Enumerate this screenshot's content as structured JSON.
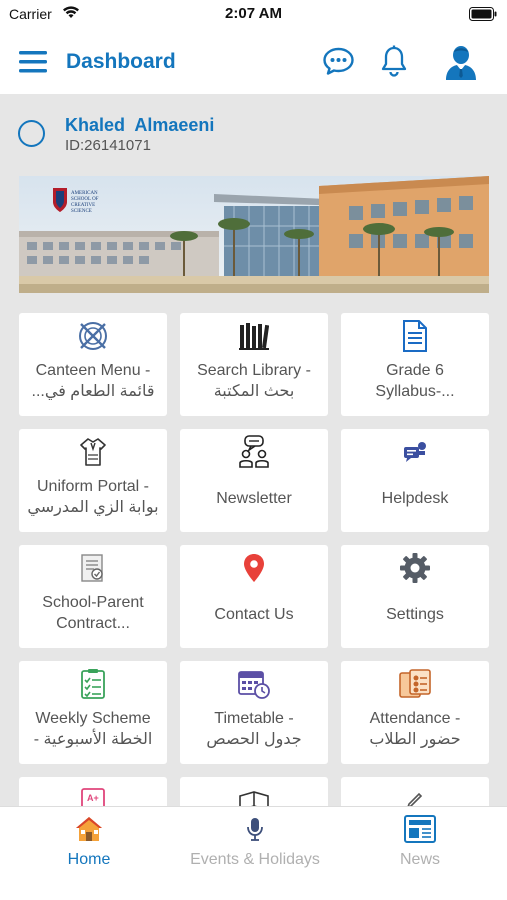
{
  "status_bar": {
    "carrier": "Carrier",
    "time": "2:07 AM"
  },
  "app_bar": {
    "title": "Dashboard"
  },
  "user": {
    "name": "Khaled  Almaeeni",
    "id": "ID:26141071"
  },
  "banner": {
    "school_name": "AMERICAN SCHOOL OF CREATIVE SCIENCE"
  },
  "tiles": [
    {
      "icon": "canteen-icon",
      "line1": "Canteen Menu -",
      "line2": "قائمة الطعام في..."
    },
    {
      "icon": "library-books-icon",
      "line1": "Search Library -",
      "line2": "بحث المكتبة"
    },
    {
      "icon": "syllabus-document-icon",
      "line1": "Grade 6",
      "line2": "Syllabus-..."
    },
    {
      "icon": "uniform-icon",
      "line1": "Uniform Portal -",
      "line2": "بوابة الزي المدرسي"
    },
    {
      "icon": "newsletter-people-icon",
      "line1": "Newsletter",
      "line2": ""
    },
    {
      "icon": "helpdesk-icon",
      "line1": "Helpdesk",
      "line2": ""
    },
    {
      "icon": "contract-icon",
      "line1": "School-Parent",
      "line2": "Contract..."
    },
    {
      "icon": "map-pin-icon",
      "line1": "Contact Us",
      "line2": ""
    },
    {
      "icon": "gear-icon",
      "line1": "Settings",
      "line2": ""
    },
    {
      "icon": "checklist-icon",
      "line1": "Weekly Scheme",
      "line2": "الخطة الأسبوعية -"
    },
    {
      "icon": "calendar-clock-icon",
      "line1": "Timetable -",
      "line2": "جدول الحصص"
    },
    {
      "icon": "attendance-icon",
      "line1": "Attendance -",
      "line2": "حضور الطلاب"
    }
  ],
  "tabs": [
    {
      "label": "Home",
      "icon": "home-icon",
      "active": true
    },
    {
      "label": "Events & Holidays",
      "icon": "microphone-icon",
      "active": false
    },
    {
      "label": "News",
      "icon": "newspaper-icon",
      "active": false
    }
  ],
  "colors": {
    "accent": "#1476bd",
    "background": "#e6e6e6",
    "tile": "#ffffff",
    "inactive_tab": "#b0b0b0"
  }
}
